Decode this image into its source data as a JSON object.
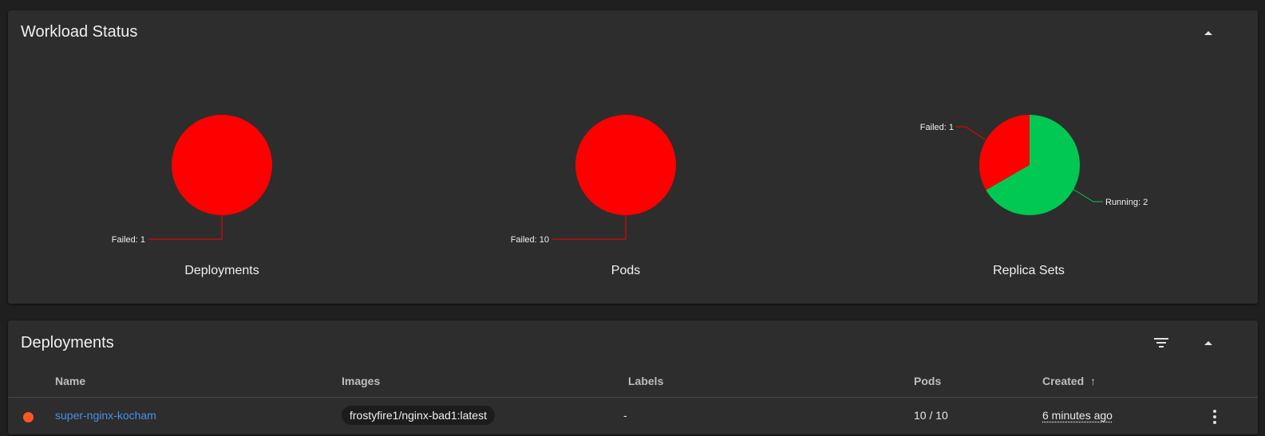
{
  "workload": {
    "title": "Workload Status",
    "charts": [
      {
        "caption": "Deployments",
        "slices": [
          {
            "label": "Failed: 1",
            "value": 1,
            "color": "#ff0000"
          }
        ]
      },
      {
        "caption": "Pods",
        "slices": [
          {
            "label": "Failed: 10",
            "value": 10,
            "color": "#ff0000"
          }
        ]
      },
      {
        "caption": "Replica Sets",
        "slices": [
          {
            "label": "Failed: 1",
            "value": 1,
            "color": "#ff0000"
          },
          {
            "label": "Running: 2",
            "value": 2,
            "color": "#00c853"
          }
        ]
      }
    ]
  },
  "chart_data": [
    {
      "type": "pie",
      "title": "Deployments",
      "categories": [
        "Failed"
      ],
      "values": [
        1
      ]
    },
    {
      "type": "pie",
      "title": "Pods",
      "categories": [
        "Failed"
      ],
      "values": [
        10
      ]
    },
    {
      "type": "pie",
      "title": "Replica Sets",
      "categories": [
        "Failed",
        "Running"
      ],
      "values": [
        1,
        2
      ]
    }
  ],
  "deployments": {
    "title": "Deployments",
    "columns": {
      "name": "Name",
      "images": "Images",
      "labels": "Labels",
      "pods": "Pods",
      "created": "Created",
      "sort_arrow": "↑"
    },
    "rows": [
      {
        "status_color": "#ff5722",
        "name": "super-nginx-kocham",
        "image": "frostyfire1/nginx-bad1:latest",
        "labels": "-",
        "pods": "10 / 10",
        "created": "6 minutes ago"
      }
    ]
  },
  "icons": {
    "collapse": "collapse-up-icon",
    "filter": "filter-icon",
    "more": "more-vert-icon"
  }
}
